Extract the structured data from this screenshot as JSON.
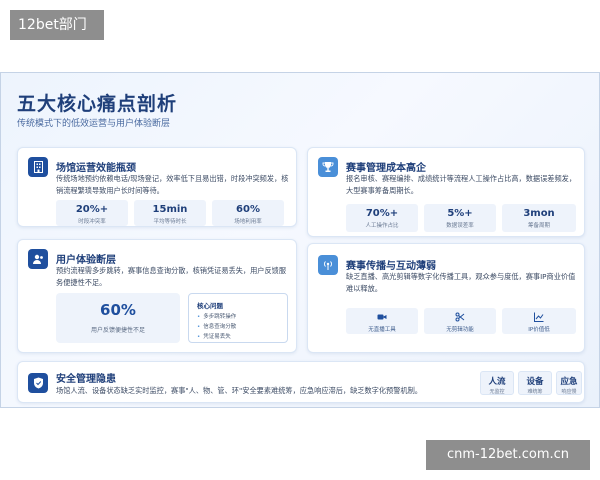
{
  "watermark_top": "12bet部门",
  "watermark_bottom": "cnm-12bet.com.cn",
  "slide": {
    "title": "五大核心痛点剖析",
    "subtitle": "传统模式下的低效运营与用户体验断层"
  },
  "cards": {
    "venue": {
      "title": "场馆运营效能瓶颈",
      "desc": "传统场地预约依赖电话/现场登记，效率低下且易出错，时段冲突频发，核销流程繁琐导致用户长时间等待。",
      "stats": [
        {
          "value": "20%+",
          "label": "时段冲突率"
        },
        {
          "value": "15min",
          "label": "平均等待时长"
        },
        {
          "value": "60%",
          "label": "场地利用率"
        }
      ]
    },
    "event": {
      "title": "赛事管理成本高企",
      "desc": "报名审核、赛程编排、成绩统计等流程人工操作占比高，数据误差频发，大型赛事筹备周期长。",
      "stats": [
        {
          "value": "70%+",
          "label": "人工操作占比"
        },
        {
          "value": "5%+",
          "label": "数据误差率"
        },
        {
          "value": "3mon",
          "label": "筹备周期"
        }
      ]
    },
    "user": {
      "title": "用户体验断层",
      "desc": "预约流程需多步跳转，赛事信息查询分散，核销凭证易丢失，用户反馈服务便捷性不足。",
      "big_value": "60%",
      "big_label": "用户反馈便捷性不足",
      "core_title": "核心问题",
      "core_items": [
        "多步跳转操作",
        "信息查询分散",
        "凭证易丢失"
      ]
    },
    "broadcast": {
      "title": "赛事传播与互动薄弱",
      "desc": "缺乏直播、高光剪辑等数字化传播工具，观众参与度低，赛事IP商业价值难以释放。",
      "features": [
        {
          "label": "无直播工具",
          "icon": "video-icon"
        },
        {
          "label": "无剪辑功能",
          "icon": "scissors-icon"
        },
        {
          "label": "IP价值低",
          "icon": "chart-icon"
        }
      ]
    },
    "security": {
      "title": "安全管理隐患",
      "desc": "场馆人流、设备状态缺乏实时监控，赛事\"人、物、管、环\"安全要素难统筹，应急响应滞后，缺乏数字化预警机制。",
      "tags": [
        {
          "value": "人流",
          "label": "无监控"
        },
        {
          "value": "设备",
          "label": "难统筹"
        },
        {
          "value": "应急",
          "label": "响应慢"
        }
      ]
    }
  },
  "colors": {
    "accent": "#1f4f9e",
    "accent_light": "#4a8fd8",
    "title": "#1f3f7a"
  }
}
